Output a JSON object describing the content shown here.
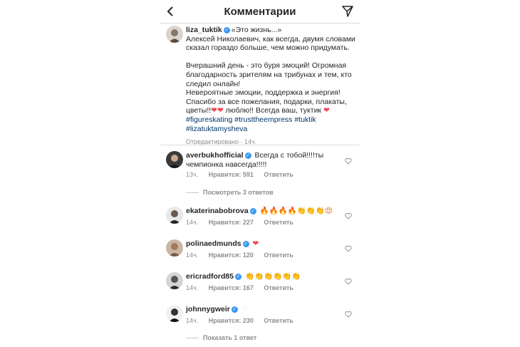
{
  "header": {
    "title": "Комментарии"
  },
  "caption": {
    "username": "liza_tuktik",
    "line1": "«Это жизнь...»",
    "line2": "Алексей Николаевич, как всегда, двумя словами сказал гораздо больше, чем можно придумать.",
    "para2": "Вчерашний день - это буря эмоций!  Огромная благодарность зрителям на трибунах и тем, кто следил онлайн!",
    "para3": "Невероятные эмоции, поддержка и энергия!",
    "para4a": "Спасибо за все пожелания, подарки, плакаты, цветы!!",
    "para4b": " люблю!! Всегда ваш, туктик ",
    "hashtags": "#figureskating #trusttheempress #tuktik #lizatuktamysheva",
    "meta": "Отредактировано · 14ч."
  },
  "comments": [
    {
      "username": "averbukhofficial",
      "text": "Всегда с тобой!!!!ты чемпионка навсегда!!!!!",
      "time": "13ч.",
      "likes": "Нравится: 591",
      "reply": "Ответить"
    },
    {
      "username": "ekaterinabobrova",
      "text": "🔥🔥🔥🔥👏👏👏😍",
      "time": "14ч.",
      "likes": "Нравится: 227",
      "reply": "Ответить"
    },
    {
      "username": "polinaedmunds",
      "text": "❤",
      "time": "14ч.",
      "likes": "Нравится: 120",
      "reply": "Ответить"
    },
    {
      "username": "ericradford85",
      "text": "👏👏👏👏👏👏",
      "time": "14ч.",
      "likes": "Нравится: 167",
      "reply": "Ответить"
    },
    {
      "username": "johnnygweir",
      "text": "♡",
      "time": "14ч.",
      "likes": "Нравится: 230",
      "reply": "Ответить"
    }
  ],
  "view_replies_1": "Посмотреть 3 ответов",
  "view_replies_2": "Показать 1 ответ",
  "colors": {
    "accent": "#3897f0",
    "heart": "#ed4956",
    "hashtag": "#00376b",
    "muted": "#8e8e8e"
  },
  "icons": [
    "back-arrow-icon",
    "send-icon",
    "verified-icon",
    "heart-outline-icon"
  ]
}
